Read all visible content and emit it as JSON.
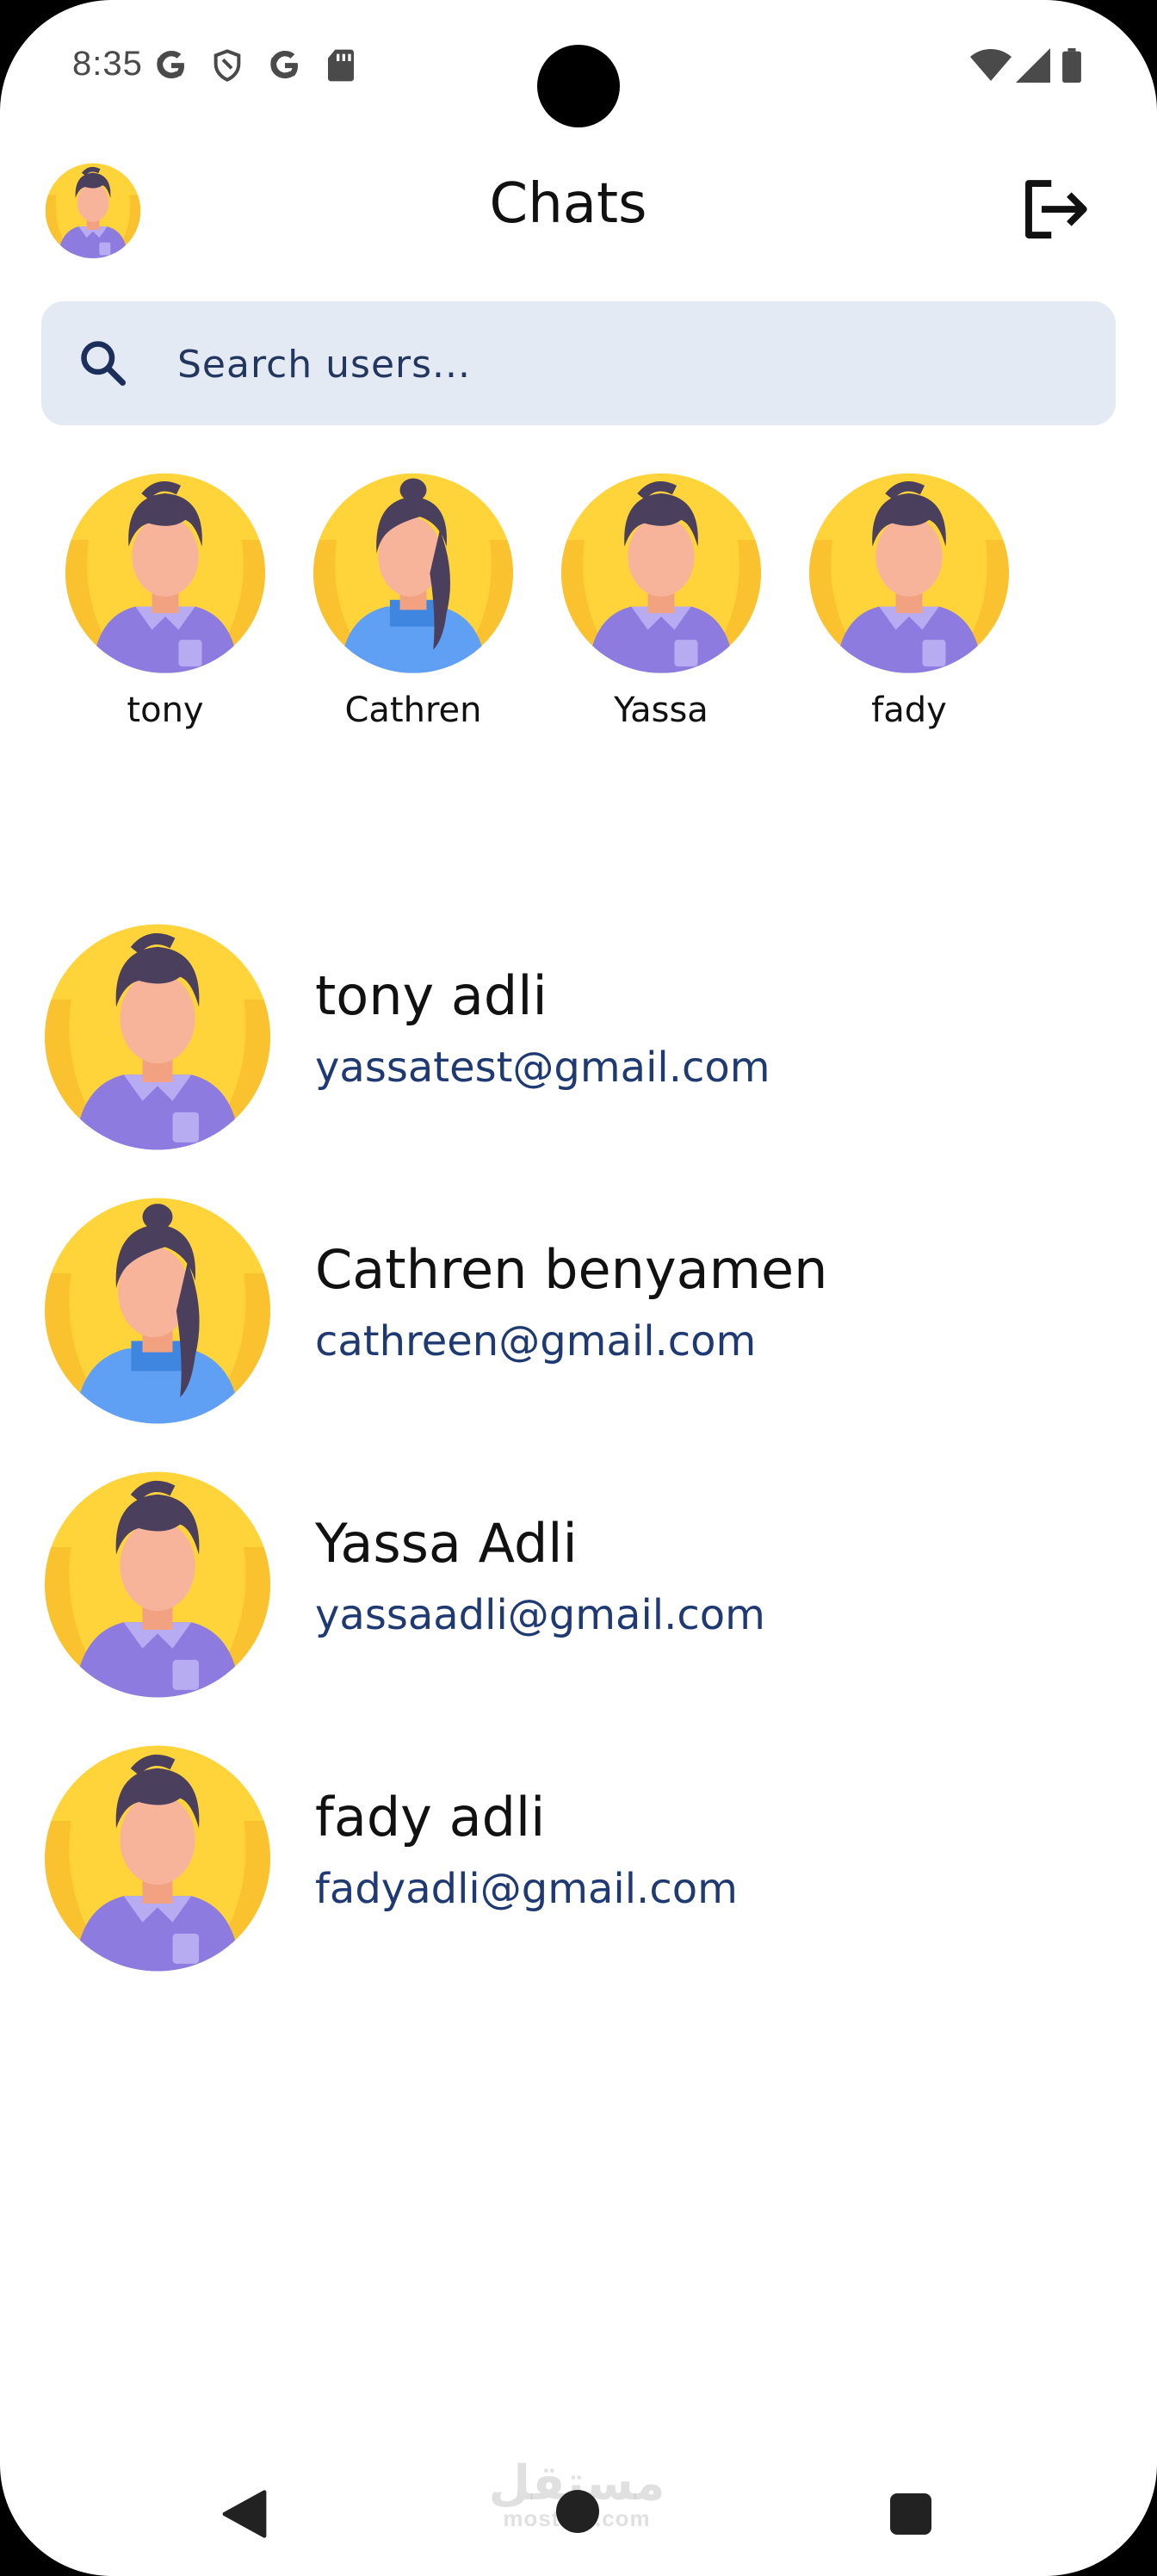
{
  "status_bar": {
    "time": "8:35",
    "left_icons": [
      "google-g-icon",
      "shield-icon",
      "google-g-icon",
      "sd-card-icon"
    ],
    "right_icons": [
      "wifi-icon",
      "signal-icon",
      "battery-icon"
    ]
  },
  "header": {
    "title": "Chats",
    "logout_icon": "logout-icon"
  },
  "search": {
    "placeholder": "Search users...",
    "value": ""
  },
  "stories": [
    {
      "name": "tony",
      "avatar": "male"
    },
    {
      "name": "Cathren",
      "avatar": "female"
    },
    {
      "name": "Yassa",
      "avatar": "male"
    },
    {
      "name": "fady",
      "avatar": "male"
    }
  ],
  "chats": [
    {
      "name": "tony adli",
      "email": "yassatest@gmail.com",
      "avatar": "male"
    },
    {
      "name": "Cathren benyamen",
      "email": "cathreen@gmail.com",
      "avatar": "female"
    },
    {
      "name": "Yassa Adli",
      "email": "yassaadli@gmail.com",
      "avatar": "male"
    },
    {
      "name": "fady adli",
      "email": "fadyadli@gmail.com",
      "avatar": "male"
    }
  ],
  "watermark": {
    "text": "مستقل",
    "subtext": "mostaql.com"
  },
  "colors": {
    "background": "#ffffff",
    "search_background": "#e3eaf3",
    "email_text": "#1f3a73",
    "avatar_yellow": "#ffd43b",
    "avatar_purple": "#8d7be0",
    "avatar_blue": "#5fa0f4"
  }
}
